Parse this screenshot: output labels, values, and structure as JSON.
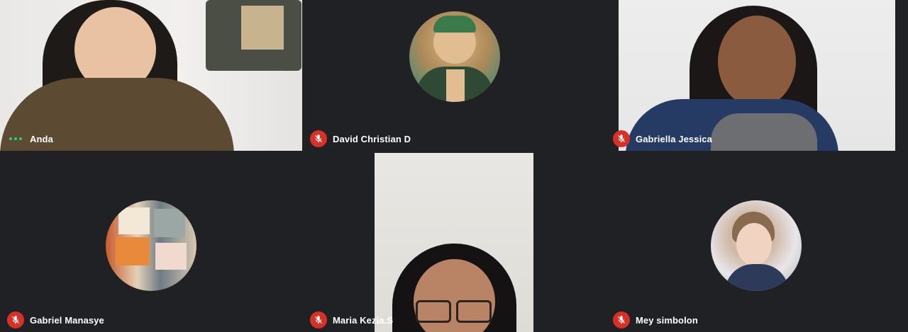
{
  "participants": [
    {
      "name": "Anda",
      "muted": false,
      "status_icon": "speaking-dots-icon"
    },
    {
      "name": "David Christian D",
      "muted": true,
      "status_icon": "mic-off-icon"
    },
    {
      "name": "Gabriella Jessica",
      "muted": true,
      "status_icon": "mic-off-icon"
    },
    {
      "name": "Gabriel Manasye",
      "muted": true,
      "status_icon": "mic-off-icon"
    },
    {
      "name": "Maria Kezia.S",
      "muted": true,
      "status_icon": "mic-off-icon"
    },
    {
      "name": "Mey simbolon",
      "muted": true,
      "status_icon": "mic-off-icon"
    }
  ],
  "colors": {
    "background": "#202124",
    "mute_red": "#d93025",
    "speaking_green": "#1fd18c"
  }
}
